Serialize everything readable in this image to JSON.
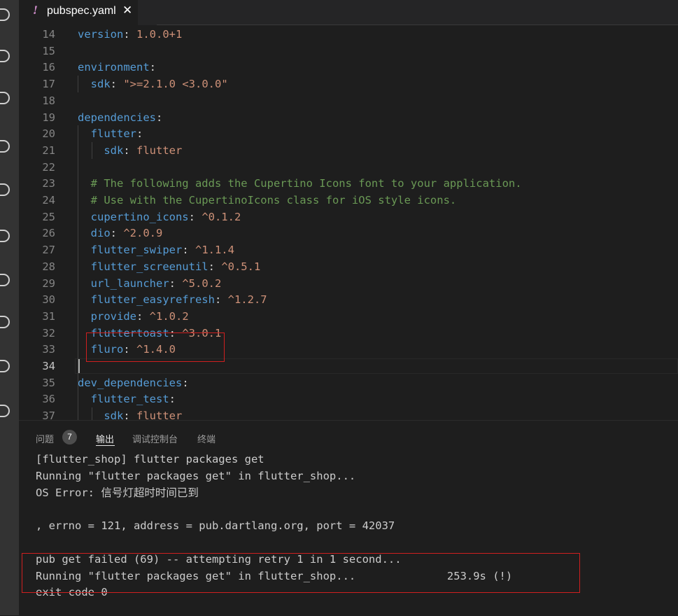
{
  "tab": {
    "icon_glyph": "!",
    "title": "pubspec.yaml",
    "close_glyph": "✕"
  },
  "editor": {
    "lines": [
      {
        "n": "14",
        "segs": [
          {
            "t": "version",
            "c": "k"
          },
          {
            "t": ": ",
            "c": "p"
          },
          {
            "t": "1.0.0+1",
            "c": "v"
          }
        ]
      },
      {
        "n": "15",
        "segs": []
      },
      {
        "n": "16",
        "segs": [
          {
            "t": "environment",
            "c": "k"
          },
          {
            "t": ":",
            "c": "p"
          }
        ]
      },
      {
        "n": "17",
        "segs": [
          {
            "t": "  sdk",
            "c": "k"
          },
          {
            "t": ": ",
            "c": "p"
          },
          {
            "t": "\">=2.1.0 <3.0.0\"",
            "c": "v"
          }
        ]
      },
      {
        "n": "18",
        "segs": []
      },
      {
        "n": "19",
        "segs": [
          {
            "t": "dependencies",
            "c": "k"
          },
          {
            "t": ":",
            "c": "p"
          }
        ]
      },
      {
        "n": "20",
        "segs": [
          {
            "t": "  flutter",
            "c": "k"
          },
          {
            "t": ":",
            "c": "p"
          }
        ]
      },
      {
        "n": "21",
        "segs": [
          {
            "t": "    sdk",
            "c": "k"
          },
          {
            "t": ": ",
            "c": "p"
          },
          {
            "t": "flutter",
            "c": "v"
          }
        ]
      },
      {
        "n": "22",
        "segs": []
      },
      {
        "n": "23",
        "segs": [
          {
            "t": "  # The following adds the Cupertino Icons font to your application.",
            "c": "c"
          }
        ]
      },
      {
        "n": "24",
        "segs": [
          {
            "t": "  # Use with the CupertinoIcons class for iOS style icons.",
            "c": "c"
          }
        ]
      },
      {
        "n": "25",
        "segs": [
          {
            "t": "  cupertino_icons",
            "c": "k"
          },
          {
            "t": ": ",
            "c": "p"
          },
          {
            "t": "^0.1.2",
            "c": "v"
          }
        ]
      },
      {
        "n": "26",
        "segs": [
          {
            "t": "  dio",
            "c": "k"
          },
          {
            "t": ": ",
            "c": "p"
          },
          {
            "t": "^2.0.9",
            "c": "v"
          }
        ]
      },
      {
        "n": "27",
        "segs": [
          {
            "t": "  flutter_swiper",
            "c": "k"
          },
          {
            "t": ": ",
            "c": "p"
          },
          {
            "t": "^1.1.4",
            "c": "v"
          }
        ]
      },
      {
        "n": "28",
        "segs": [
          {
            "t": "  flutter_screenutil",
            "c": "k"
          },
          {
            "t": ": ",
            "c": "p"
          },
          {
            "t": "^0.5.1",
            "c": "v"
          }
        ]
      },
      {
        "n": "29",
        "segs": [
          {
            "t": "  url_launcher",
            "c": "k"
          },
          {
            "t": ": ",
            "c": "p"
          },
          {
            "t": "^5.0.2",
            "c": "v"
          }
        ]
      },
      {
        "n": "30",
        "segs": [
          {
            "t": "  flutter_easyrefresh",
            "c": "k"
          },
          {
            "t": ": ",
            "c": "p"
          },
          {
            "t": "^1.2.7",
            "c": "v"
          }
        ]
      },
      {
        "n": "31",
        "segs": [
          {
            "t": "  provide",
            "c": "k"
          },
          {
            "t": ": ",
            "c": "p"
          },
          {
            "t": "^1.0.2",
            "c": "v"
          }
        ]
      },
      {
        "n": "32",
        "segs": [
          {
            "t": "  fluttertoast",
            "c": "k"
          },
          {
            "t": ": ",
            "c": "p"
          },
          {
            "t": "^3.0.1",
            "c": "v"
          }
        ]
      },
      {
        "n": "33",
        "segs": [
          {
            "t": "  fluro",
            "c": "k"
          },
          {
            "t": ": ",
            "c": "p"
          },
          {
            "t": "^1.4.0",
            "c": "v"
          }
        ]
      },
      {
        "n": "34",
        "segs": []
      },
      {
        "n": "35",
        "segs": [
          {
            "t": "dev_dependencies",
            "c": "k"
          },
          {
            "t": ":",
            "c": "p"
          }
        ]
      },
      {
        "n": "36",
        "segs": [
          {
            "t": "  flutter_test",
            "c": "k"
          },
          {
            "t": ":",
            "c": "p"
          }
        ]
      },
      {
        "n": "37",
        "segs": [
          {
            "t": "    sdk",
            "c": "k"
          },
          {
            "t": ": ",
            "c": "p"
          },
          {
            "t": "flutter",
            "c": "v"
          }
        ]
      }
    ],
    "current_line": "34"
  },
  "panel": {
    "tabs": {
      "problems": "问题",
      "problems_count": "7",
      "output": "输出",
      "debug_console": "调试控制台",
      "terminal": "终端"
    },
    "output": [
      "[flutter_shop] flutter packages get",
      "Running \"flutter packages get\" in flutter_shop...",
      "OS Error: 信号灯超时时间已到",
      "",
      ", errno = 121, address = pub.dartlang.org, port = 42037",
      "",
      "pub get failed (69) -- attempting retry 1 in 1 second...",
      "Running \"flutter packages get\" in flutter_shop...              253.9s (!)",
      "exit code 0"
    ]
  },
  "colors": {
    "keyword": "#569cd6",
    "string": "#ce9178",
    "comment": "#6a9955",
    "highlight_box": "#d02020"
  }
}
